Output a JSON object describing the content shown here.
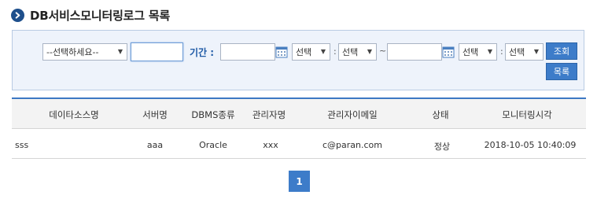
{
  "page_title": "DB서비스모니터링로그 목록",
  "search": {
    "select_default": "--선택하세요--",
    "text_value": "",
    "period_label": "기간 :",
    "start_date": "",
    "end_date": "",
    "hour_select": "선택",
    "minute_select": "선택",
    "colon": ":",
    "tilde": "~",
    "search_button": "조회",
    "list_button": "목록"
  },
  "table": {
    "columns": [
      "데이타소스명",
      "서버명",
      "DBMS종류",
      "관리자명",
      "관리자이메일",
      "상태",
      "모니터링시각"
    ],
    "rows": [
      [
        "sss",
        "aaa",
        "Oracle",
        "xxx",
        "c@paran.com",
        "정상",
        "2018-10-05 10:40:09"
      ]
    ]
  },
  "pagination": {
    "current_page": "1"
  },
  "colors": {
    "accent": "#3d7cc9",
    "title_icon": "#1e4f8c",
    "search_bg": "#eef3fb"
  }
}
